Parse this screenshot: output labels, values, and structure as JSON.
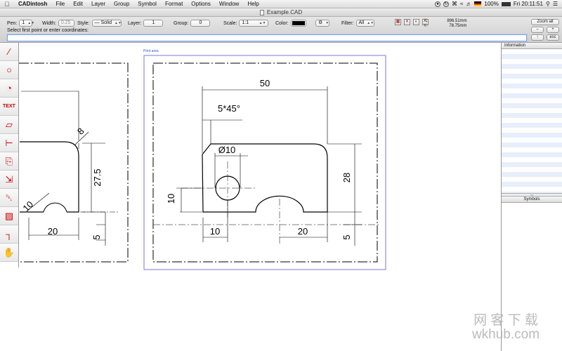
{
  "menubar": {
    "app_name": "CADintosh",
    "items": [
      "File",
      "Edit",
      "Layer",
      "Group",
      "Symbol",
      "Format",
      "Options",
      "Window",
      "Help"
    ],
    "battery": "100%",
    "clock": "Fri 20:11:51"
  },
  "window": {
    "title": "Example.CAD"
  },
  "toolbar": {
    "pen": {
      "label": "Pen:",
      "value": "1"
    },
    "width": {
      "label": "Width:",
      "value": "0.25"
    },
    "style": {
      "label": "Style:",
      "value": "Solid"
    },
    "layer": {
      "label": "Layer:",
      "value": "1"
    },
    "group": {
      "label": "Group:",
      "value": "0"
    },
    "scale": {
      "label": "Scale:",
      "value": "1:1"
    },
    "color": {
      "label": "Color:",
      "value": "#000000"
    },
    "filter": {
      "label": "Filter:",
      "value": "All"
    },
    "prompt": "Select first point or enter coordinates:",
    "command_value": "",
    "coords": {
      "x_label": "X:",
      "x": "896.51mm",
      "y_label": "Y:",
      "y": "78.75mm"
    },
    "zoom": {
      "all": "Zoom all",
      "minus": "–",
      "plus": "+",
      "up": "↑",
      "esc": "esc"
    }
  },
  "tools": [
    {
      "name": "line-tool",
      "glyph": "∕"
    },
    {
      "name": "circle-tool",
      "glyph": "○"
    },
    {
      "name": "arc-tool",
      "glyph": "◔"
    },
    {
      "name": "text-tool",
      "glyph": "TEXT"
    },
    {
      "name": "dimension-tool",
      "glyph": "▱"
    },
    {
      "name": "trim-tool",
      "glyph": "⊢"
    },
    {
      "name": "copy-tool",
      "glyph": "⎘"
    },
    {
      "name": "move-tool",
      "glyph": "⇲"
    },
    {
      "name": "delete-tool",
      "glyph": "␡"
    },
    {
      "name": "hatch-tool",
      "glyph": "▨"
    },
    {
      "name": "fillet-tool",
      "glyph": "┐"
    },
    {
      "name": "pan-tool",
      "glyph": "✋"
    }
  ],
  "canvas": {
    "print_area_label": "Print area",
    "dims": {
      "width_50": "50",
      "chamfer": "5*45°",
      "diameter": "Ø10",
      "height_28": "28",
      "height_10": "10",
      "offset_10": "10",
      "width_20": "20",
      "height_5": "5",
      "left_width_20": "20",
      "left_height": "27.5",
      "left_height_5": "5",
      "left_fillet_8": "8",
      "left_radius_10": "10"
    }
  },
  "sidebar": {
    "information_title": "Information",
    "symbols_title": "Symbols"
  },
  "watermark": {
    "line1": "网 客 下 载",
    "line2": "wkhub.com"
  }
}
